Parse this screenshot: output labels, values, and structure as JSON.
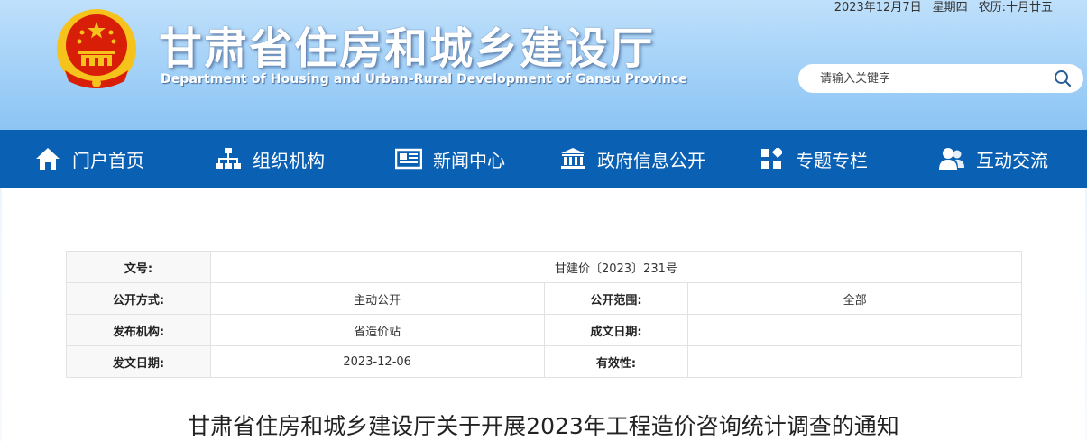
{
  "header": {
    "date": "2023年12月7日",
    "weekday": "星期四",
    "lunar": "农历:十月廿五",
    "title": "甘肃省住房和城乡建设厅",
    "subtitle": "Department of Housing and Urban-Rural Development of Gansu Province",
    "search_placeholder": "请输入关键字"
  },
  "nav": {
    "items": [
      {
        "label": "门户首页",
        "icon": "home-icon"
      },
      {
        "label": "组织机构",
        "icon": "org-chart-icon"
      },
      {
        "label": "新闻中心",
        "icon": "newspaper-icon"
      },
      {
        "label": "政府信息公开",
        "icon": "government-building-icon"
      },
      {
        "label": "专题专栏",
        "icon": "grid-icon"
      },
      {
        "label": "互动交流",
        "icon": "users-icon"
      }
    ]
  },
  "doc_info": {
    "doc_no_label": "文号:",
    "doc_no": "甘建价〔2023〕231号",
    "disclosure_method_label": "公开方式:",
    "disclosure_method": "主动公开",
    "disclosure_scope_label": "公开范围:",
    "disclosure_scope": "全部",
    "publisher_label": "发布机构:",
    "publisher": "省造价站",
    "written_date_label": "成文日期:",
    "written_date": "",
    "issue_date_label": "发文日期:",
    "issue_date": "2023-12-06",
    "validity_label": "有效性:",
    "validity": ""
  },
  "article": {
    "title": "甘肃省住房和城乡建设厅关于开展2023年工程造价咨询统计调查的通知"
  },
  "colors": {
    "nav_bg": "#0a61b4",
    "header_bg": "#a7d3f8",
    "emblem_red": "#d81e06",
    "emblem_gold": "#f6c21c"
  }
}
